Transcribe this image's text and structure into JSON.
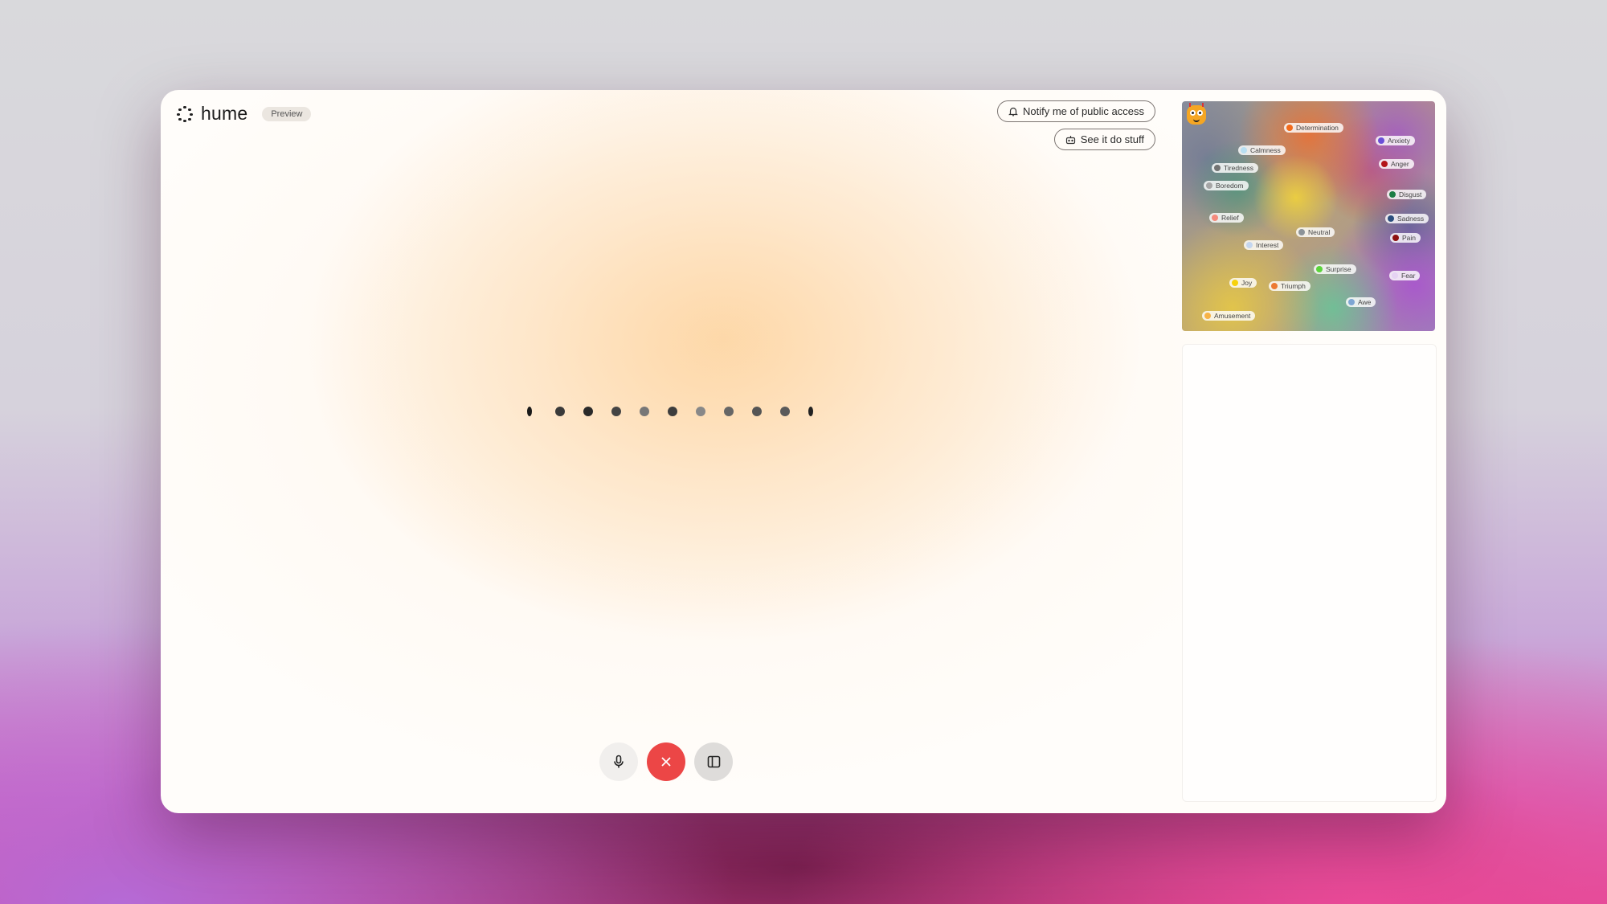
{
  "app": {
    "brand": "hume",
    "badge": "Preview"
  },
  "header": {
    "notify_label": "Notify me of public access",
    "notify_icon": "bell-icon",
    "see_it_label": "See it do stuff",
    "see_it_icon": "robot-icon"
  },
  "controls": {
    "mic_icon": "microphone-icon",
    "end_icon": "close-icon",
    "panel_icon": "sidebar-panel-icon",
    "colors": {
      "end": "#ec4646",
      "mic": "#f1efed",
      "panel": "#dedcda"
    }
  },
  "emotion_map": {
    "avatar_icon": "smiley-face-icon",
    "emotions": [
      {
        "label": "Determination",
        "color": "#f26a1b"
      },
      {
        "label": "Anxiety",
        "color": "#6b4fd8"
      },
      {
        "label": "Calmness",
        "color": "#b8dff2"
      },
      {
        "label": "Tiredness",
        "color": "#737373"
      },
      {
        "label": "Anger",
        "color": "#b3141a"
      },
      {
        "label": "Boredom",
        "color": "#a5a5a5"
      },
      {
        "label": "Disgust",
        "color": "#1e7d45"
      },
      {
        "label": "Relief",
        "color": "#f48a7c"
      },
      {
        "label": "Sadness",
        "color": "#2b4f7e"
      },
      {
        "label": "Neutral",
        "color": "#8c9398"
      },
      {
        "label": "Pain",
        "color": "#8d1010"
      },
      {
        "label": "Interest",
        "color": "#c4d6ef"
      },
      {
        "label": "Surprise",
        "color": "#5bd43b"
      },
      {
        "label": "Fear",
        "color": "#e6d3f3"
      },
      {
        "label": "Joy",
        "color": "#f7d20c"
      },
      {
        "label": "Triumph",
        "color": "#ec7a32"
      },
      {
        "label": "Awe",
        "color": "#7ea6d3"
      },
      {
        "label": "Amusement",
        "color": "#f7b246"
      }
    ]
  }
}
